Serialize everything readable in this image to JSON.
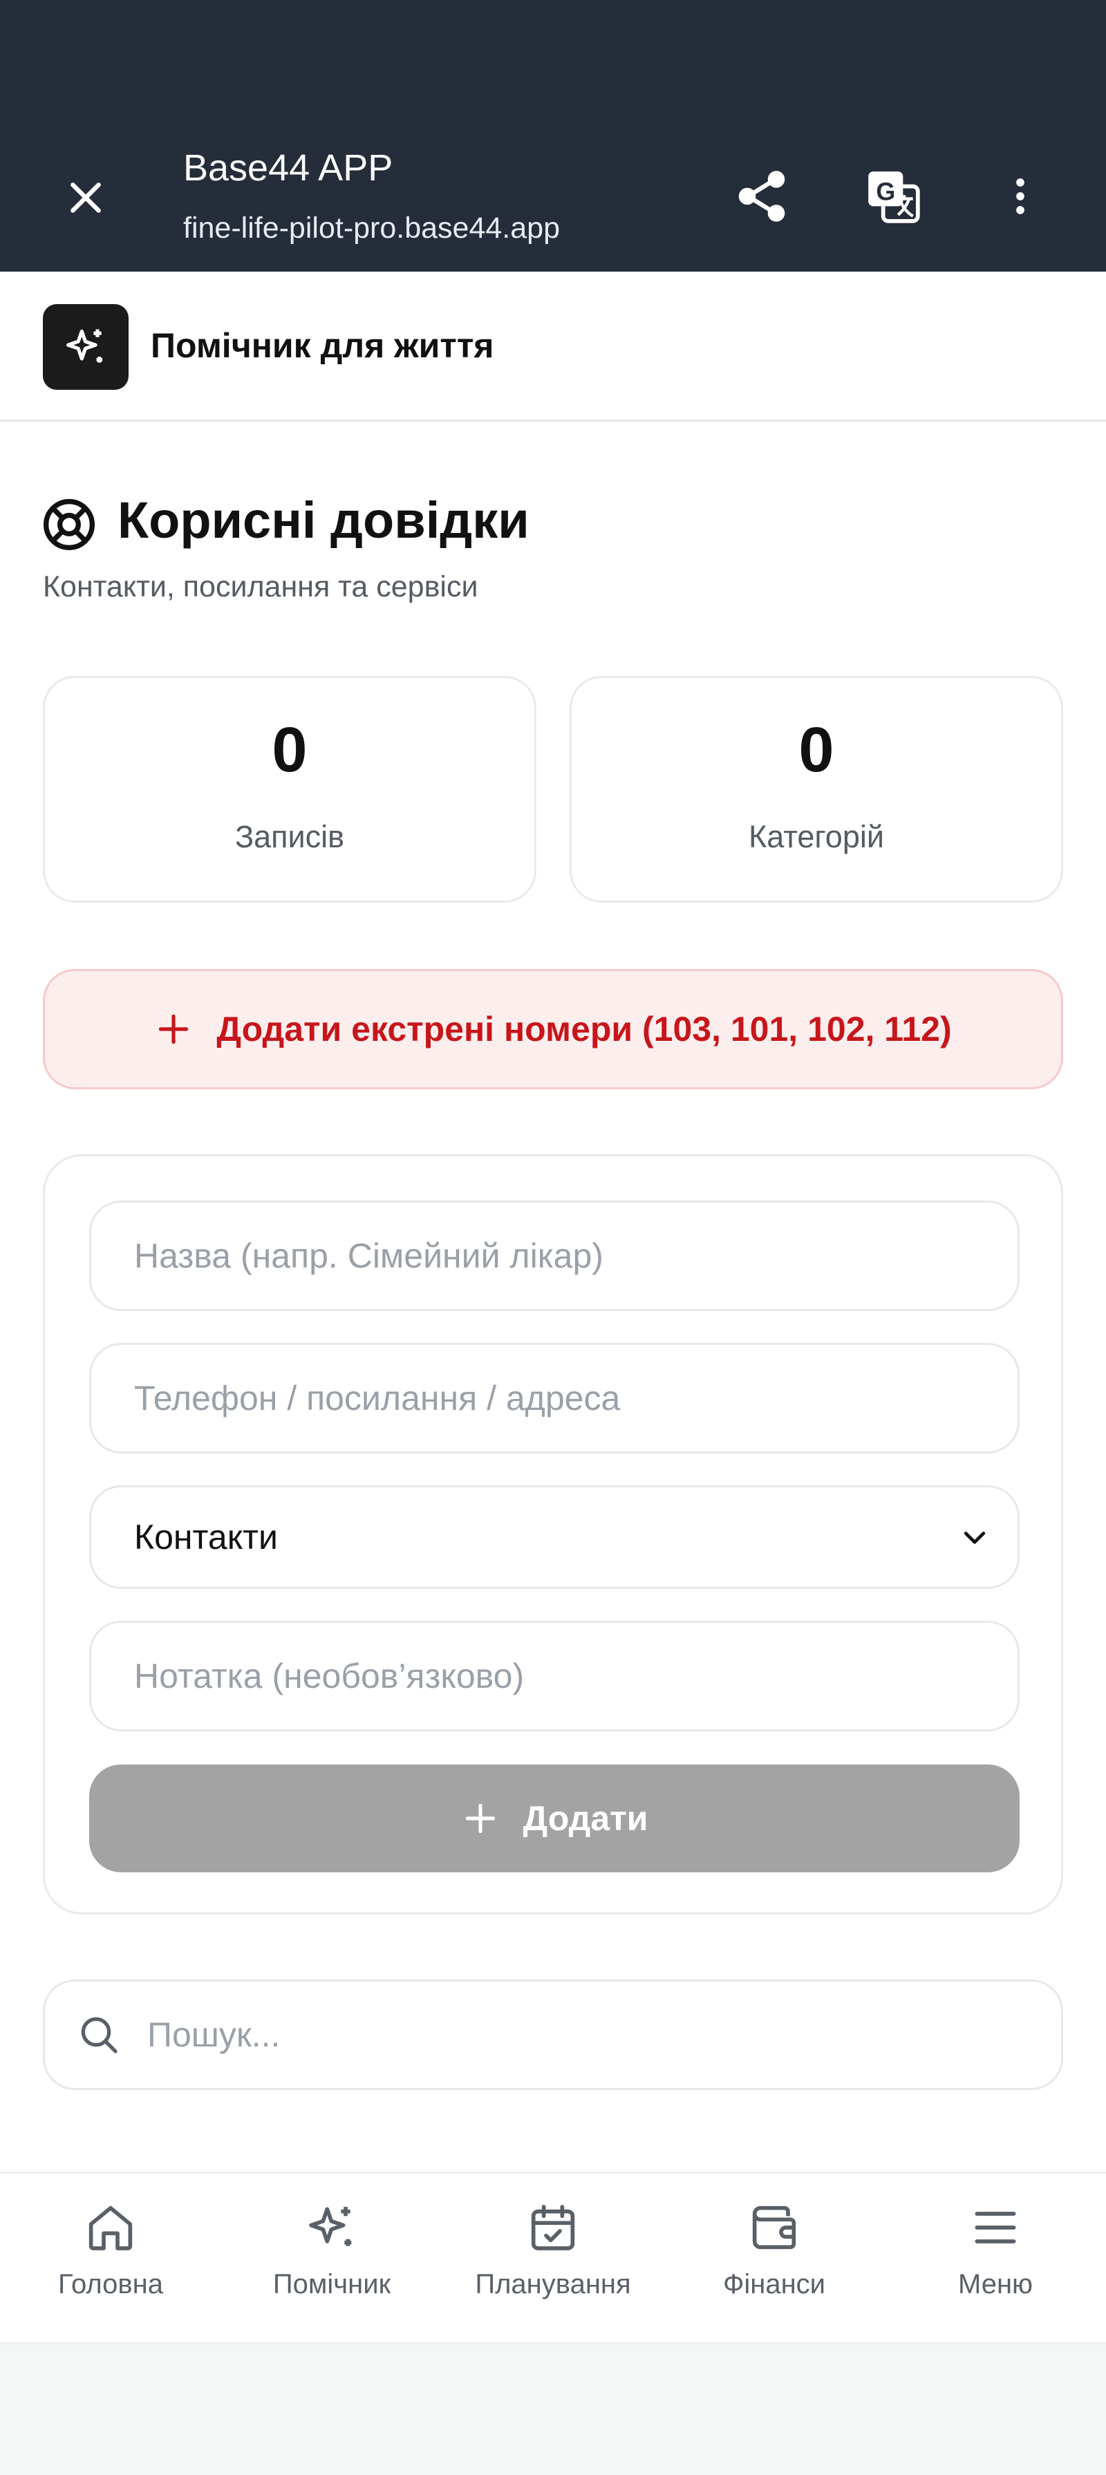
{
  "browser": {
    "title": "Base44 APP",
    "url": "fine-life-pilot-pro.base44.app",
    "close_icon": "close-icon",
    "share_icon": "share-icon",
    "translate_icon": "translate-icon",
    "more_icon": "more-vertical-icon"
  },
  "app": {
    "name": "Помічник для життя",
    "logo_icon": "sparkles-icon"
  },
  "page": {
    "icon": "lifebuoy-icon",
    "title": "Корисні довідки",
    "subtitle": "Контакти, посилання та сервіси"
  },
  "stats": [
    {
      "value": "0",
      "label": "Записів"
    },
    {
      "value": "0",
      "label": "Категорій"
    }
  ],
  "emergency_button": {
    "label": "Додати екстрені номери (103, 101, 102, 112)",
    "icon": "plus-icon",
    "color": "#c7161b"
  },
  "form": {
    "name_placeholder": "Назва (напр. Сімейний лікар)",
    "contact_placeholder": "Телефон / посилання / адреса",
    "category_selected": "Контакти",
    "note_placeholder": "Нотатка (необов’язково)",
    "submit_label": "Додати"
  },
  "search": {
    "placeholder": "Пошук...",
    "icon": "search-icon"
  },
  "nav": [
    {
      "label": "Головна",
      "icon": "home-icon"
    },
    {
      "label": "Помічник",
      "icon": "sparkles-icon"
    },
    {
      "label": "Планування",
      "icon": "calendar-check-icon"
    },
    {
      "label": "Фінанси",
      "icon": "wallet-icon"
    },
    {
      "label": "Меню",
      "icon": "menu-icon"
    }
  ]
}
